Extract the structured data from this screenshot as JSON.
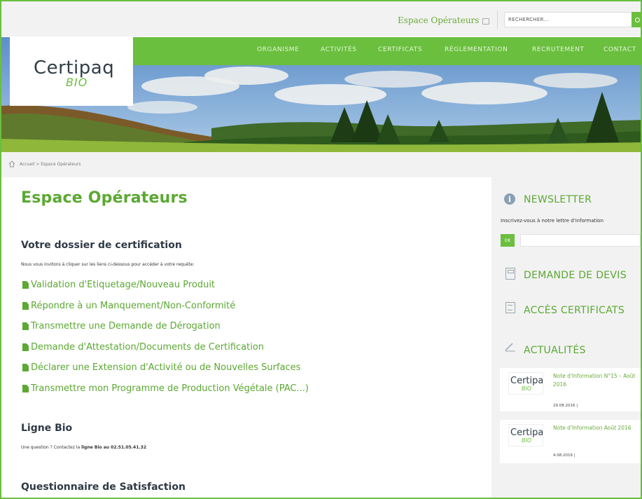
{
  "topbar": {
    "espace_label": "Espace Opérateurs",
    "search_placeholder": "RECHERCHER..."
  },
  "logo": {
    "name": "Certipaq",
    "sub": "BIO"
  },
  "nav": {
    "items": [
      "ORGANISME",
      "ACTIVITÉS",
      "CERTIFICATS",
      "RÉGLEMENTATION",
      "RECRUTEMENT",
      "CONTACT"
    ]
  },
  "breadcrumb": {
    "home": "Accueil",
    "separator": ">",
    "current": "Espace Opérateurs",
    "text": "Accueil > Espace Opérateurs"
  },
  "main": {
    "title": "Espace Opérateurs",
    "dossier": {
      "heading": "Votre dossier de certification",
      "intro": "Nous vous invitons à cliquer sur les liens ci-dessous pour accéder à votre requête:",
      "links": [
        "Validation d'Etiquetage/Nouveau Produit",
        "Répondre à un Manquement/Non-Conformité",
        "Transmettre une Demande de Dérogation",
        "Demande d'Attestation/Documents de Certification",
        "Déclarer une Extension d'Activité ou de Nouvelles Surfaces",
        "Transmettre mon Programme de Production Végétale (PAC...)"
      ]
    },
    "ligne_bio": {
      "heading": "Ligne Bio",
      "text_before": "Une question ? Contactez la ",
      "text_bold": "ligne Bio au 02.51.05.41.32"
    },
    "questionnaire": {
      "heading": "Questionnaire de Satisfaction"
    }
  },
  "sidebar": {
    "newsletter": {
      "title": "NEWSLETTER",
      "text": "Inscrivez-vous à notre lettre d'information",
      "button": "OK"
    },
    "devis": {
      "title": "DEMANDE DE DEVIS"
    },
    "certificats": {
      "title": "ACCÈS CERTIFICATS"
    },
    "actualites": {
      "title": "ACTUALITÉS",
      "items": [
        {
          "title": "Note d'Information N°15 – Août 2016",
          "date": "29.08.2016 |"
        },
        {
          "title": "Note d'Information Août 2016",
          "date": "4.08.2016 |"
        }
      ]
    }
  },
  "colors": {
    "brand_green": "#6abf3e",
    "link_green": "#5ba832",
    "dark_text": "#2f3a46"
  }
}
